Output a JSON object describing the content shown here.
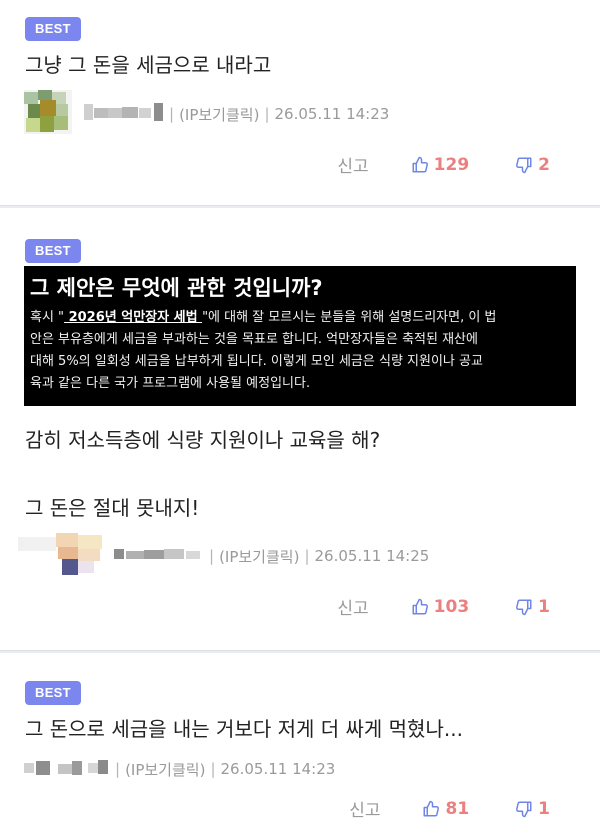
{
  "comments": [
    {
      "badge": "BEST",
      "text": "그냥 그 돈을 세금으로 내라고",
      "ip_label": "(IP보기클릭)",
      "timestamp": "26.05.11 14:23",
      "report": "신고",
      "likes": "129",
      "dislikes": "2"
    },
    {
      "badge": "BEST",
      "quote": {
        "title": "그 제안은 무엇에 관한 것입니까?",
        "prefix": "혹시 \"",
        "link": " 2026년 억만장자 세법 ",
        "line1_rest": "\"에 대해 잘 모르시는 분들을 위해 설명드리자면, 이 법",
        "line2": "안은 부유층에게 세금을 부과하는 것을 목표로 합니다. 억만장자들은 축적된 재산에",
        "line3": "대해 5%의 일회성 세금을 납부하게 됩니다. 이렇게 모인 세금은 식량 지원이나 공교",
        "line4": "육과 같은 다른 국가 프로그램에 사용될 예정입니다."
      },
      "text_line1": "감히 저소득층에 식량 지원이나 교육을 해?",
      "text_line2": "그 돈은 절대 못내지!",
      "ip_label": "(IP보기클릭)",
      "timestamp": "26.05.11 14:25",
      "report": "신고",
      "likes": "103",
      "dislikes": "1"
    },
    {
      "badge": "BEST",
      "text": "그 돈으로 세금을 내는 거보다 저게 더 싸게 먹혔나...",
      "ip_label": "(IP보기클릭)",
      "timestamp": "26.05.11 14:23",
      "report": "신고",
      "likes": "81",
      "dislikes": "1"
    }
  ],
  "colors": {
    "badge": "#7b87ee",
    "count": "#ec7f7f",
    "thumb": "#6f86e6",
    "meta": "#9a9a9a"
  },
  "icons": [
    "thumbs-up-icon",
    "thumbs-down-icon",
    "avatar"
  ]
}
